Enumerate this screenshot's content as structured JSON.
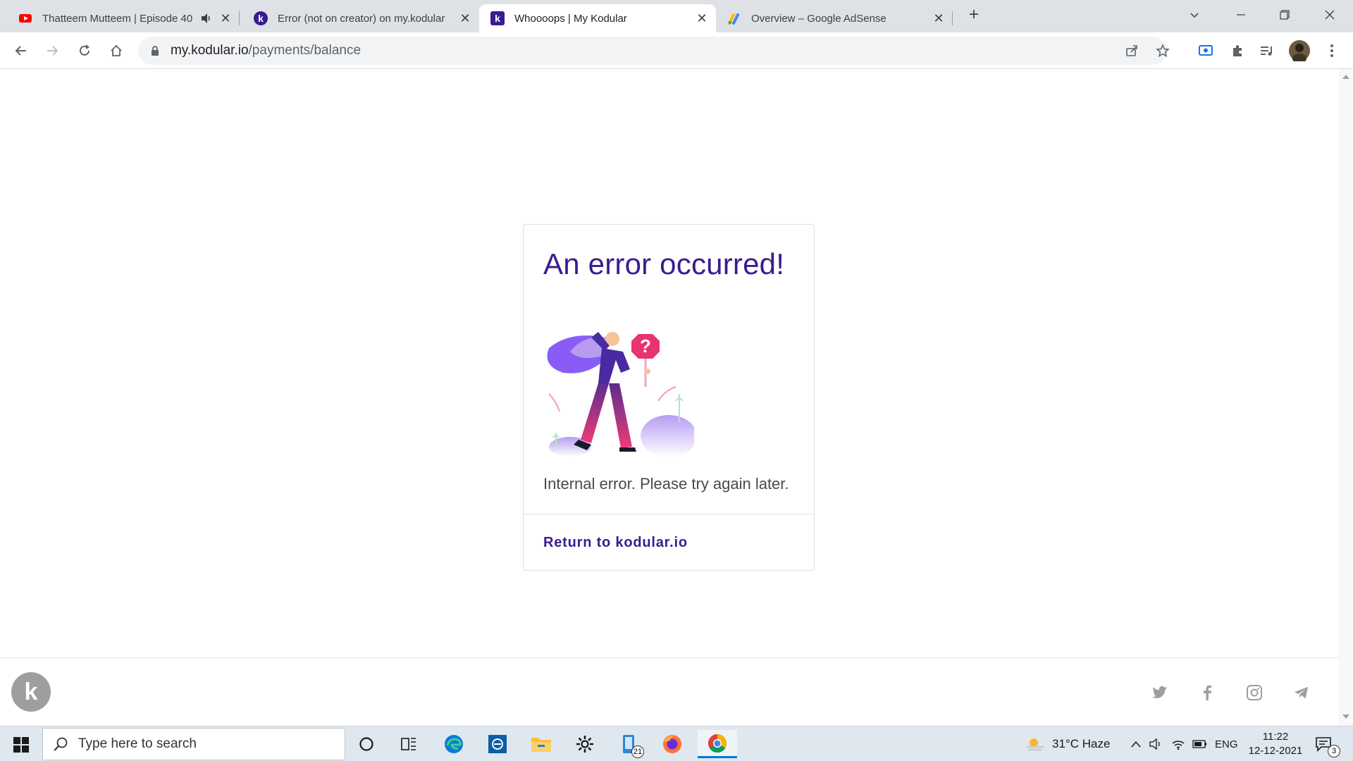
{
  "browser": {
    "tabs": [
      {
        "title": "Thatteem Mutteem | Episode 40",
        "favicon": "youtube-icon",
        "audio": true,
        "active": false
      },
      {
        "title": "Error (not on creator) on my.kodular",
        "favicon": "kodular-icon",
        "audio": false,
        "active": false
      },
      {
        "title": "Whoooops | My Kodular",
        "favicon": "kodular-icon",
        "audio": false,
        "active": true
      },
      {
        "title": "Overview – Google AdSense",
        "favicon": "adsense-icon",
        "audio": false,
        "active": false
      }
    ],
    "new_tab": "+",
    "url_host": "my.kodular.io",
    "url_path": "/payments/balance"
  },
  "page": {
    "heading": "An error occurred!",
    "message": "Internal error. Please try again later.",
    "link": "Return to kodular.io",
    "illustration_sign": "?",
    "logo_letter": "k",
    "colors": {
      "primary": "#3a1c8f",
      "sign": "#e8336f",
      "accent": "#8a5cf6"
    }
  },
  "footer": {
    "social": [
      "twitter-icon",
      "facebook-icon",
      "instagram-icon",
      "telegram-icon"
    ]
  },
  "taskbar": {
    "search_placeholder": "Type here to search",
    "weather": "31°C  Haze",
    "language": "ENG",
    "time": "11:22",
    "date": "12-12-2021",
    "store_badge": "21",
    "notif_badge": "3"
  }
}
